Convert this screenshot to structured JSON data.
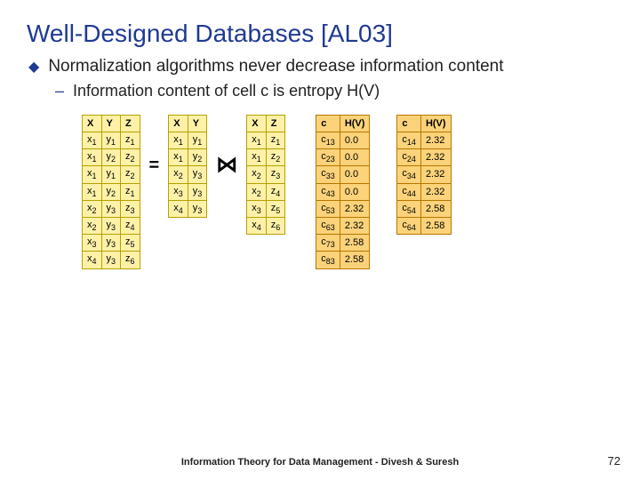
{
  "title": "Well-Designed Databases [AL03]",
  "bullet": "Normalization algorithms never decrease information content",
  "subbullet": "Information content of cell c is entropy H(V)",
  "eq": "=",
  "join": "⋈",
  "tableXYZ": {
    "headers": [
      "X",
      "Y",
      "Z"
    ],
    "rows": [
      [
        "x1",
        "y1",
        "z1"
      ],
      [
        "x1",
        "y2",
        "z2"
      ],
      [
        "x1",
        "y1",
        "z2"
      ],
      [
        "x1",
        "y2",
        "z1"
      ],
      [
        "x2",
        "y3",
        "z3"
      ],
      [
        "x2",
        "y3",
        "z4"
      ],
      [
        "x3",
        "y3",
        "z5"
      ],
      [
        "x4",
        "y3",
        "z6"
      ]
    ]
  },
  "tableXY": {
    "headers": [
      "X",
      "Y"
    ],
    "rows": [
      [
        "x1",
        "y1"
      ],
      [
        "x1",
        "y2"
      ],
      [
        "x2",
        "y3"
      ],
      [
        "x3",
        "y3"
      ],
      [
        "x4",
        "y3"
      ]
    ]
  },
  "tableXZ": {
    "headers": [
      "X",
      "Z"
    ],
    "rows": [
      [
        "x1",
        "z1"
      ],
      [
        "x1",
        "z2"
      ],
      [
        "x2",
        "z3"
      ],
      [
        "x2",
        "z4"
      ],
      [
        "x3",
        "z5"
      ],
      [
        "x4",
        "z6"
      ]
    ]
  },
  "tableCH1": {
    "headers": [
      "c",
      "H(V)"
    ],
    "rows": [
      [
        "c13",
        "0.0"
      ],
      [
        "c23",
        "0.0"
      ],
      [
        "c33",
        "0.0"
      ],
      [
        "c43",
        "0.0"
      ],
      [
        "c53",
        "2.32"
      ],
      [
        "c63",
        "2.32"
      ],
      [
        "c73",
        "2.58"
      ],
      [
        "c83",
        "2.58"
      ]
    ]
  },
  "tableCH2": {
    "headers": [
      "c",
      "H(V)"
    ],
    "rows": [
      [
        "c14",
        "2.32"
      ],
      [
        "c24",
        "2.32"
      ],
      [
        "c34",
        "2.32"
      ],
      [
        "c44",
        "2.32"
      ],
      [
        "c54",
        "2.58"
      ],
      [
        "c64",
        "2.58"
      ]
    ]
  },
  "footer": "Information Theory for Data Management - Divesh & Suresh",
  "pagenum": "72"
}
